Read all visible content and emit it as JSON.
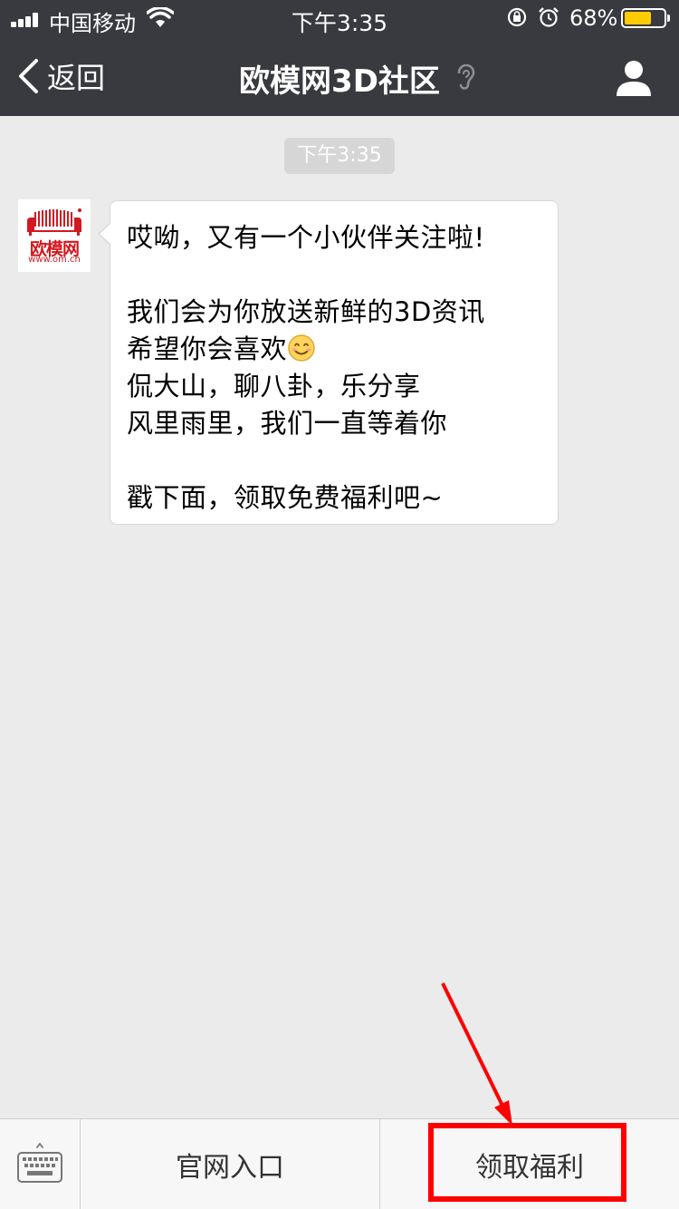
{
  "status_bar": {
    "carrier": "中国移动",
    "time": "下午3:35",
    "battery_percent": "68%",
    "battery_level": 0.68,
    "icons": [
      "signal-icon",
      "wifi-icon",
      "rotation-lock-icon",
      "alarm-icon",
      "battery-icon"
    ]
  },
  "nav": {
    "back_label": "返回",
    "title": "欧模网3D社区",
    "icons": [
      "chevron-left-icon",
      "ear-icon",
      "profile-icon"
    ]
  },
  "chat": {
    "timestamp": "下午3:35",
    "sender": {
      "avatar_brand": "欧模网",
      "avatar_url": "www.om.cn"
    },
    "message_lines": {
      "l1": "哎呦，又有一个小伙伴关注啦!",
      "l2": "我们会为你放送新鲜的3D资讯",
      "l3": "希望你会喜欢",
      "l4": "侃大山，聊八卦，乐分享",
      "l5": "风里雨里，我们一直等着你",
      "l6": "戳下面，领取免费福利吧~"
    }
  },
  "bottom_menu": {
    "items": [
      {
        "label": "官网入口"
      },
      {
        "label": "领取福利"
      }
    ]
  },
  "colors": {
    "nav_bg": "#393a3f",
    "chat_bg": "#ebebeb",
    "brand_red": "#d3181f",
    "annotation_red": "#ff0000",
    "battery_fill": "#ffcc00"
  }
}
